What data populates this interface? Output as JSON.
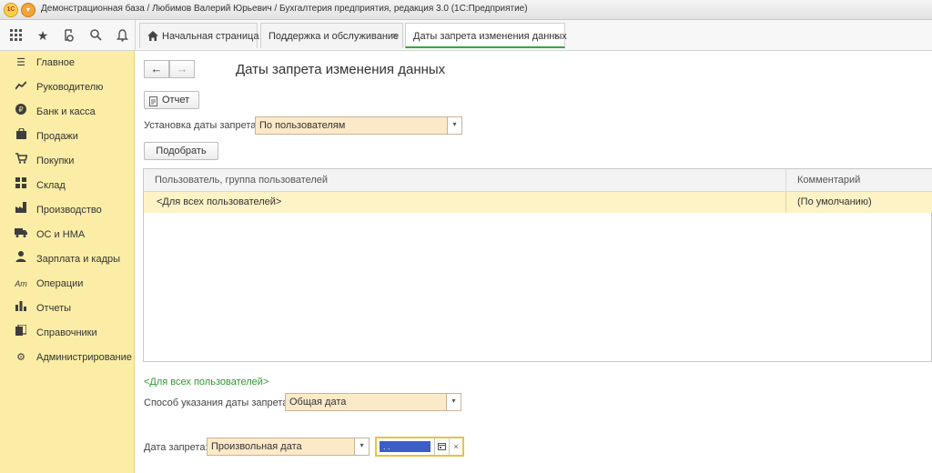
{
  "window": {
    "title": "Демонстрационная база / Любимов Валерий Юрьевич / Бухгалтерия предприятия, редакция 3.0  (1С:Предприятие)",
    "logo_text": "1С"
  },
  "toolbar": {
    "icons": [
      "apps-grid-icon",
      "favorites-star-icon",
      "history-icon",
      "search-icon",
      "notifications-bell-icon"
    ],
    "tabs": [
      {
        "label": "Начальная страница",
        "icon": "home-icon"
      },
      {
        "label": "Поддержка и обслуживание",
        "close": "×"
      },
      {
        "label": "Даты запрета изменения данных",
        "close": "×"
      }
    ]
  },
  "sidebar": {
    "items": [
      {
        "label": "Главное",
        "icon": "menu-lines-icon"
      },
      {
        "label": "Руководителю",
        "icon": "trend-chart-icon"
      },
      {
        "label": "Банк и касса",
        "icon": "ruble-coin-icon"
      },
      {
        "label": "Продажи",
        "icon": "shopping-bag-icon"
      },
      {
        "label": "Покупки",
        "icon": "cart-icon"
      },
      {
        "label": "Склад",
        "icon": "warehouse-icon"
      },
      {
        "label": "Производство",
        "icon": "factory-icon"
      },
      {
        "label": "ОС и НМА",
        "icon": "truck-icon"
      },
      {
        "label": "Зарплата и кадры",
        "icon": "person-icon"
      },
      {
        "label": "Операции",
        "icon": "operations-icon"
      },
      {
        "label": "Отчеты",
        "icon": "bar-chart-icon"
      },
      {
        "label": "Справочники",
        "icon": "books-icon"
      },
      {
        "label": "Администрирование",
        "icon": "gear-icon"
      }
    ]
  },
  "form": {
    "title": "Даты запрета изменения данных",
    "report_button": "Отчет",
    "restriction_label": "Установка даты запрета:",
    "restriction_value": "По пользователям",
    "select_button": "Подобрать",
    "table": {
      "columns": [
        "Пользователь, группа пользователей",
        "Комментарий"
      ],
      "rows": [
        {
          "user": "<Для всех пользователей>",
          "comment": "(По умолчанию)"
        }
      ]
    },
    "section_link": "<Для всех пользователей>",
    "method_label": "Способ указания даты запрета:",
    "method_value": "Общая дата",
    "date_label": "Дата запрета:",
    "date_type_value": "Произвольная дата",
    "date_value": " .  .",
    "date_clear": "×"
  },
  "colors": {
    "sidebar_bg": "#fbeda5",
    "input_bg": "#fce9c8",
    "active_tab_accent": "#3aa53a",
    "link_green": "#2f9a2f",
    "focus_border": "#e8c247",
    "selected_row": "#fdf3c6"
  }
}
